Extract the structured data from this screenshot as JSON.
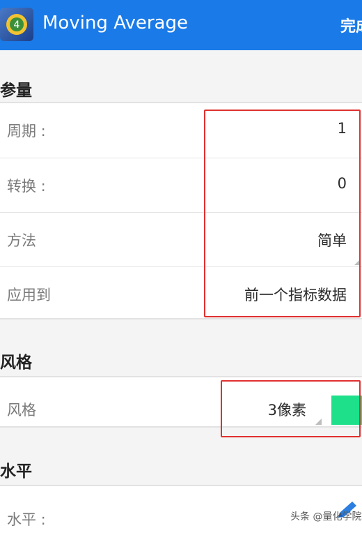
{
  "appbar": {
    "title": "Moving Average",
    "done_label": "完成",
    "color": "#1a7ae8"
  },
  "params": {
    "header": "参量",
    "rows": [
      {
        "label": "周期 :",
        "value": "1"
      },
      {
        "label": "转换 :",
        "value": "0"
      },
      {
        "label": "方法",
        "value": "简单"
      },
      {
        "label": "应用到",
        "value": "前一个指标数据"
      }
    ]
  },
  "style": {
    "header": "风格",
    "row_label": "风格",
    "width_value": "3像素",
    "color": "#1ee08a"
  },
  "level": {
    "header": "水平",
    "row_label": "水平 :"
  },
  "watermark": "头条 @量化学院",
  "highlight_color": "#e03030",
  "icons": [
    "app-logo-icon",
    "dropdown-corner-icon",
    "edit-pencil-icon"
  ]
}
